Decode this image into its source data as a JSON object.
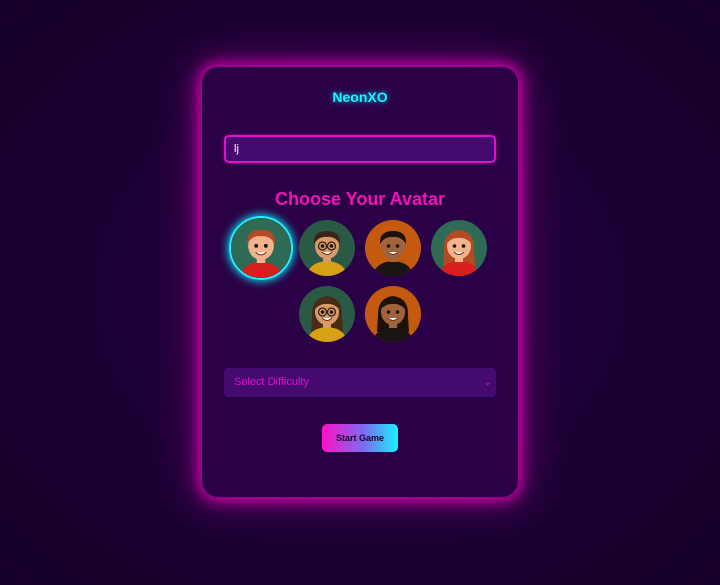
{
  "app": {
    "title": "NeonXO"
  },
  "player_name": {
    "value": "lj"
  },
  "avatars": {
    "heading": "Choose Your Avatar",
    "selected_index": 0,
    "items": [
      {
        "id": "avatar-boy-red-hair",
        "bg": "#2f6a55",
        "skin": "#f2b48c",
        "hair": "#b34a22",
        "shirt": "#d81e1e"
      },
      {
        "id": "avatar-boy-glasses",
        "bg": "#2a5a45",
        "skin": "#d99a6a",
        "hair": "#3a2616",
        "shirt": "#d8a014"
      },
      {
        "id": "avatar-boy-dark",
        "bg": "#c45a10",
        "skin": "#a0643c",
        "hair": "#1c120a",
        "shirt": "#1a1412"
      },
      {
        "id": "avatar-girl-red-hair",
        "bg": "#2f6a55",
        "skin": "#f2b48c",
        "hair": "#b34a22",
        "shirt": "#d81e1e"
      },
      {
        "id": "avatar-girl-glasses",
        "bg": "#2a5a45",
        "skin": "#d99a6a",
        "hair": "#4a2c16",
        "shirt": "#d8a014"
      },
      {
        "id": "avatar-girl-dark",
        "bg": "#c45a10",
        "skin": "#a0643c",
        "hair": "#1c120a",
        "shirt": "#1a1412"
      }
    ]
  },
  "difficulty": {
    "placeholder": "Select Difficulty"
  },
  "start": {
    "label": "Start Game"
  },
  "colors": {
    "cyan": "#22f0ff",
    "magenta": "#f012b4",
    "card_bg": "#2a0046",
    "field_bg": "#440a6e"
  }
}
